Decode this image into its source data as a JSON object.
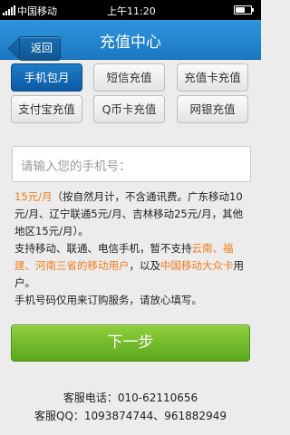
{
  "status_bar": {
    "carrier": "中国移动",
    "time": "上午11:20"
  },
  "nav": {
    "back_label": "返回",
    "title": "充值中心"
  },
  "tabs": [
    {
      "label": "手机包月",
      "active": true
    },
    {
      "label": "短信充值",
      "active": false
    },
    {
      "label": "充值卡充值",
      "active": false
    },
    {
      "label": "支付宝充值",
      "active": false
    },
    {
      "label": "Q币卡充值",
      "active": false
    },
    {
      "label": "网银充值",
      "active": false
    }
  ],
  "phone_field": {
    "placeholder": "请输入您的手机号："
  },
  "info": {
    "price": "15元/月",
    "price_detail": "（按自然月计，不含通讯费。广东移动10元/月、辽宁联通5元/月、吉林移动25元/月，其他地区15元/月）。",
    "support_prefix": "支持移动、联通、电信手机，暂不支持",
    "unsupported_regions": "云南、福建、河南三省的移动用户",
    "support_mid": "，以及",
    "unsupported_card": "中国移动大众卡",
    "support_suffix": "用户。",
    "note": "手机号码仅用来订购服务，请放心填写。"
  },
  "next_button": "下一步",
  "customer_service": {
    "phone": "客服电话：010-62110656",
    "qq": "客服QQ：1093874744、961882949"
  },
  "colors": {
    "nav_blue": "#1a78c2",
    "active_tab": "#0e5aa3",
    "highlight_orange": "#f57b18",
    "button_green": "#5aa81e"
  }
}
